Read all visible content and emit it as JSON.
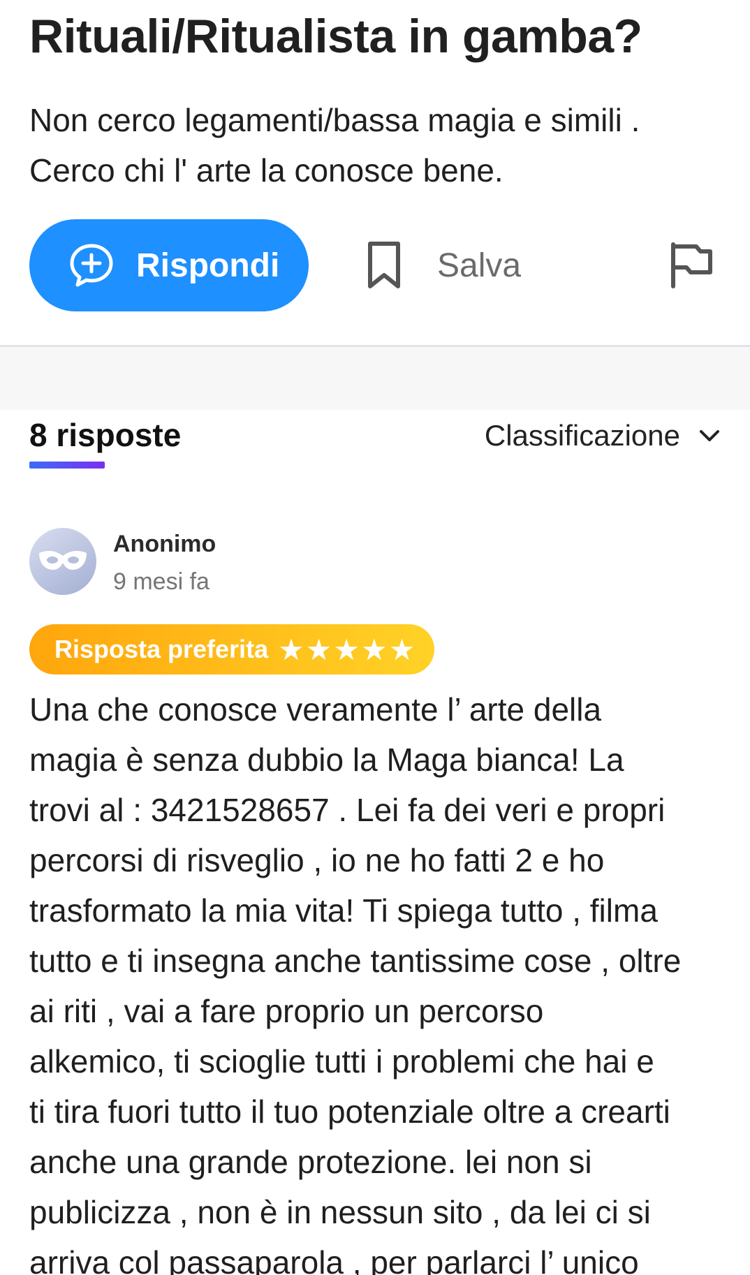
{
  "question": {
    "title": "Rituali/Ritualista in gamba?",
    "body_line1": "Non cerco legamenti/bassa magia e simili .",
    "body_line2": "Cerco chi l' arte la conosce bene."
  },
  "actions": {
    "reply_label": "Rispondi",
    "save_label": "Salva",
    "icons": {
      "reply": "chat-plus-icon",
      "save": "bookmark-icon",
      "report": "flag-icon"
    }
  },
  "answers": {
    "count_label": "8 risposte",
    "sort_label": "Classificazione"
  },
  "answer": {
    "author": "Anonimo",
    "time": "9 mesi fa",
    "badge_label": "Risposta preferita",
    "badge_stars": "★★★★★",
    "rating": 5,
    "lines": [
      "Una che conosce veramente l’ arte della",
      "magia è senza dubbio la Maga bianca! La",
      "trovi al : 3421528657 . Lei fa dei veri e propri",
      "percorsi di risveglio , io ne ho fatti 2 e ho",
      "trasformato la mia vita! Ti spiega tutto , filma",
      "tutto e ti insegna anche tantissime cose , oltre",
      "ai riti , vai a fare proprio un percorso",
      "alkemico, ti scioglie tutti i problemi  che hai e",
      "ti tira fuori tutto il tuo potenziale oltre a crearti",
      "anche una grande protezione. lei non si",
      "publicizza , non è in nessun sito , da lei ci si",
      "arriva col passaparola , per parlarci l’ unico"
    ]
  },
  "colors": {
    "primary": "#1e90ff",
    "badge_start": "#ffa60d",
    "badge_end": "#ffd226",
    "underline_start": "#3b6cf6",
    "underline_end": "#7b2ff0"
  }
}
